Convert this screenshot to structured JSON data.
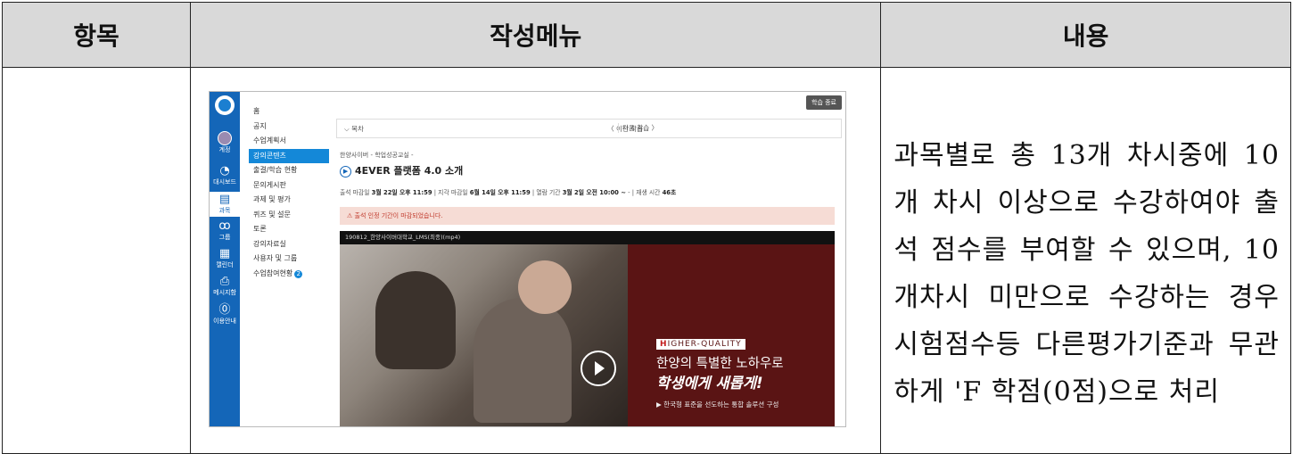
{
  "table": {
    "headers": {
      "item": "항목",
      "menu": "작성메뉴",
      "content": "내용"
    },
    "row": {
      "item": "",
      "content": "과목별로 총 13개 차시중에 10개 차시 이상으로 수강하여야 출석 점수를 부여할 수 있으며, 10개차시 미만으로 수강하는 경우 시험점수등 다른평가기준과 무관하게 'F 학점(0점)으로 처리"
    }
  },
  "screenshot": {
    "sidebar": {
      "items": [
        {
          "label": "계정",
          "icon": "avatar"
        },
        {
          "label": "대시보드",
          "icon": "dashboard-icon"
        },
        {
          "label": "과목",
          "icon": "book-icon"
        },
        {
          "label": "그룹",
          "icon": "group-icon"
        },
        {
          "label": "캘린더",
          "icon": "calendar-icon"
        },
        {
          "label": "메시지함",
          "icon": "inbox-icon"
        },
        {
          "label": "이용안내",
          "icon": "help-icon"
        }
      ]
    },
    "course_menu": [
      "홈",
      "공지",
      "수업계획서",
      "강의콘텐츠",
      "출결/학습 현황",
      "문의게시판",
      "과제 및 평가",
      "퀴즈 및 설문",
      "토론",
      "강의자료실",
      "사용자 및 그룹",
      "수업참여현황"
    ],
    "course_menu_active": "강의콘텐츠",
    "badge_count": "2",
    "exit_button": "학습 종료",
    "nav": {
      "week": "⌵ 목차",
      "prev": "〈 이전 학습",
      "next": "다음 학습 〉"
    },
    "breadcrumb": "한양사이버 - 학업성공교실 -",
    "title": "4EVER 플랫폼 4.0 소개",
    "meta": {
      "due_label": "출석 마감일",
      "due": "3월 22일 오후 11:59",
      "late_label": "| 지각 마감일",
      "late": "6월 14일 오후 11:59",
      "open_label": "| 열람 기간",
      "open": "3월 2일 오전 10:00 ~",
      "play_label": "- | 재생 시간",
      "play": "46초"
    },
    "alert": "출석 인정 기간이 마감되었습니다.",
    "video": {
      "file": "190812_한양사이버대학교_LMS(최종)(mp4)",
      "hq_first": "H",
      "hq_rest": "IGHER-QUALITY",
      "slogan1": "한양의 특별한 노하우로",
      "slogan2": "학생에게 새롭게!",
      "slogan3": "▶ 한국형 표준을 선도하는 통합 솔루션 구성"
    },
    "colors": {
      "sidebar": "#1466b8",
      "active_menu": "#1488d8",
      "alert_bg": "#f6dcd5",
      "video_panel": "#5a1414"
    }
  }
}
